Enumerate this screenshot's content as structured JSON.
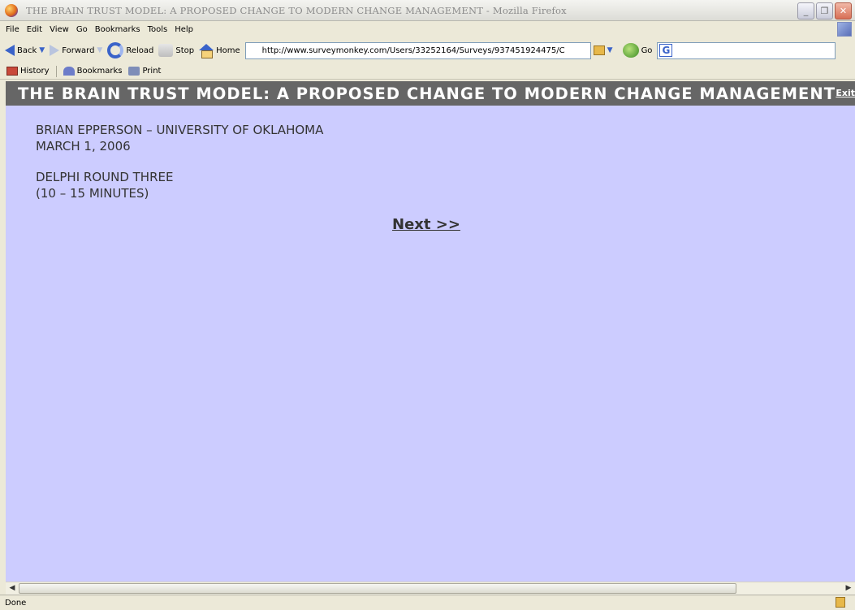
{
  "window": {
    "title": "THE BRAIN TRUST MODEL: A PROPOSED CHANGE TO MODERN CHANGE MANAGEMENT - Mozilla Firefox"
  },
  "menu": [
    "File",
    "Edit",
    "View",
    "Go",
    "Bookmarks",
    "Tools",
    "Help"
  ],
  "nav": {
    "back": "Back",
    "forward": "Forward",
    "reload": "Reload",
    "stop": "Stop",
    "home": "Home",
    "url": "http://www.surveymonkey.com/Users/33252164/Surveys/937451924475/C",
    "go": "Go"
  },
  "bookmarks_bar": [
    "History",
    "Bookmarks",
    "Print"
  ],
  "page": {
    "banner_title": "THE BRAIN TRUST MODEL: A PROPOSED CHANGE TO MODERN CHANGE MANAGEMENT",
    "exit": "Exit",
    "author_line": "BRIAN EPPERSON – UNIVERSITY OF OKLAHOMA",
    "date_line": "MARCH 1, 2006",
    "round_line": "DELPHI ROUND THREE",
    "duration_line": "(10 – 15 MINUTES)",
    "next": "Next >>"
  },
  "status": {
    "text": "Done"
  },
  "colors": {
    "page_bg": "#ccccff",
    "banner_bg": "#666666",
    "chrome_bg": "#ece9d8"
  }
}
